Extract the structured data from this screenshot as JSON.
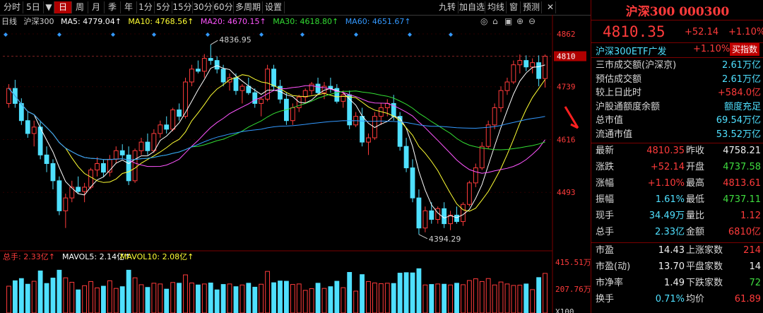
{
  "toolbar": {
    "left_items": [
      "分时",
      "5日",
      "▼",
      "日",
      "周",
      "月",
      "季",
      "年",
      "1分",
      "5分",
      "15分",
      "30分",
      "60分",
      "多周期",
      "设置"
    ],
    "active": "日",
    "right_items": [
      "九转",
      "加自选",
      "均线",
      "窗",
      "预测"
    ]
  },
  "legend": {
    "period": "日线",
    "name": "沪深300",
    "ma5": "MA5: 4779.04↑",
    "ma10": "MA10: 4768.56↑",
    "ma20": "MA20: 4670.15↑",
    "ma30": "MA30: 4618.80↑",
    "ma60": "MA60: 4651.67↑"
  },
  "vol_legend": {
    "total": "总手: 2.33亿↑",
    "mavol5": "MAVOL5: 2.14亿↑",
    "mavol10": "MAVOL10: 2.08亿↑"
  },
  "colors": {
    "up": "#ff3b3b",
    "down": "#4fe0ff",
    "ma5": "#ffffff",
    "ma10": "#ffff33",
    "ma20": "#ff55ff",
    "ma30": "#33dd33",
    "ma60": "#3399ff",
    "bg": "#000000"
  },
  "chart_data": {
    "type": "candlestick",
    "y_ticks": [
      "4862",
      "4810",
      "4739",
      "4616",
      "4493"
    ],
    "vol_ticks": [
      "415.51万",
      "207.76万",
      "X100"
    ],
    "annotations": {
      "high": "4836.95",
      "low": "4394.29"
    },
    "ylim": [
      4370,
      4880
    ],
    "ohlc": [
      [
        4700,
        4745,
        4690,
        4735
      ],
      [
        4735,
        4755,
        4690,
        4700
      ],
      [
        4700,
        4712,
        4650,
        4660
      ],
      [
        4660,
        4680,
        4620,
        4630
      ],
      [
        4630,
        4660,
        4600,
        4645
      ],
      [
        4645,
        4660,
        4570,
        4580
      ],
      [
        4580,
        4600,
        4540,
        4560
      ],
      [
        4560,
        4570,
        4500,
        4520
      ],
      [
        4520,
        4530,
        4440,
        4450
      ],
      [
        4450,
        4490,
        4410,
        4480
      ],
      [
        4480,
        4520,
        4470,
        4505
      ],
      [
        4505,
        4530,
        4490,
        4495
      ],
      [
        4495,
        4515,
        4470,
        4505
      ],
      [
        4505,
        4550,
        4500,
        4545
      ],
      [
        4545,
        4575,
        4530,
        4560
      ],
      [
        4560,
        4570,
        4530,
        4540
      ],
      [
        4540,
        4580,
        4530,
        4570
      ],
      [
        4570,
        4600,
        4560,
        4590
      ],
      [
        4590,
        4605,
        4570,
        4580
      ],
      [
        4580,
        4600,
        4510,
        4520
      ],
      [
        4520,
        4595,
        4515,
        4590
      ],
      [
        4590,
        4620,
        4580,
        4610
      ],
      [
        4610,
        4630,
        4580,
        4590
      ],
      [
        4590,
        4640,
        4585,
        4630
      ],
      [
        4630,
        4660,
        4620,
        4650
      ],
      [
        4650,
        4670,
        4630,
        4640
      ],
      [
        4640,
        4690,
        4635,
        4685
      ],
      [
        4685,
        4700,
        4660,
        4670
      ],
      [
        4670,
        4760,
        4665,
        4750
      ],
      [
        4750,
        4790,
        4740,
        4780
      ],
      [
        4780,
        4800,
        4770,
        4775
      ],
      [
        4775,
        4815,
        4760,
        4805
      ],
      [
        4805,
        4837,
        4790,
        4800
      ],
      [
        4800,
        4810,
        4770,
        4780
      ],
      [
        4780,
        4790,
        4740,
        4750
      ],
      [
        4750,
        4770,
        4730,
        4760
      ],
      [
        4760,
        4770,
        4720,
        4730
      ],
      [
        4730,
        4745,
        4700,
        4740
      ],
      [
        4740,
        4760,
        4720,
        4725
      ],
      [
        4725,
        4735,
        4690,
        4700
      ],
      [
        4700,
        4715,
        4670,
        4710
      ],
      [
        4710,
        4790,
        4705,
        4780
      ],
      [
        4780,
        4790,
        4730,
        4740
      ],
      [
        4740,
        4755,
        4700,
        4710
      ],
      [
        4710,
        4725,
        4650,
        4660
      ],
      [
        4660,
        4700,
        4650,
        4690
      ],
      [
        4690,
        4720,
        4680,
        4715
      ],
      [
        4715,
        4735,
        4700,
        4730
      ],
      [
        4730,
        4750,
        4720,
        4745
      ],
      [
        4745,
        4760,
        4720,
        4725
      ],
      [
        4725,
        4750,
        4710,
        4740
      ],
      [
        4740,
        4760,
        4725,
        4735
      ],
      [
        4735,
        4745,
        4700,
        4705
      ],
      [
        4705,
        4730,
        4690,
        4720
      ],
      [
        4720,
        4730,
        4640,
        4650
      ],
      [
        4650,
        4680,
        4645,
        4670
      ],
      [
        4670,
        4690,
        4600,
        4610
      ],
      [
        4610,
        4630,
        4580,
        4620
      ],
      [
        4620,
        4680,
        4615,
        4670
      ],
      [
        4670,
        4700,
        4650,
        4690
      ],
      [
        4690,
        4710,
        4670,
        4700
      ],
      [
        4700,
        4720,
        4660,
        4670
      ],
      [
        4670,
        4680,
        4590,
        4600
      ],
      [
        4600,
        4620,
        4540,
        4550
      ],
      [
        4550,
        4570,
        4470,
        4480
      ],
      [
        4480,
        4500,
        4395,
        4410
      ],
      [
        4410,
        4460,
        4400,
        4450
      ],
      [
        4450,
        4470,
        4420,
        4430
      ],
      [
        4430,
        4460,
        4420,
        4455
      ],
      [
        4455,
        4470,
        4410,
        4420
      ],
      [
        4420,
        4450,
        4405,
        4440
      ],
      [
        4440,
        4460,
        4420,
        4425
      ],
      [
        4425,
        4470,
        4415,
        4465
      ],
      [
        4465,
        4520,
        4460,
        4515
      ],
      [
        4515,
        4560,
        4505,
        4550
      ],
      [
        4550,
        4610,
        4545,
        4600
      ],
      [
        4600,
        4660,
        4595,
        4650
      ],
      [
        4650,
        4700,
        4640,
        4690
      ],
      [
        4690,
        4740,
        4680,
        4730
      ],
      [
        4730,
        4760,
        4720,
        4750
      ],
      [
        4750,
        4800,
        4745,
        4790
      ],
      [
        4790,
        4814,
        4770,
        4800
      ],
      [
        4800,
        4812,
        4775,
        4785
      ],
      [
        4785,
        4805,
        4770,
        4795
      ],
      [
        4795,
        4812,
        4740,
        4758
      ],
      [
        4758,
        4814,
        4737,
        4810
      ]
    ]
  },
  "side": {
    "title": "沪深300 000300",
    "price": "4810.35",
    "change": "+52.14",
    "change_pct": "+1.10%",
    "etf_name": "沪深300ETF广发",
    "etf_chg": "+1.10%",
    "etf_btn": "买指数",
    "stats": [
      {
        "label": "三市成交额(沪深京)",
        "value": "2.61万亿",
        "color": "cyan"
      },
      {
        "label": "预估成交额",
        "value": "2.61万亿",
        "color": "cyan"
      },
      {
        "label": "较上日此时",
        "value": "+584.0亿",
        "color": "red"
      },
      {
        "label": "沪股通额度余额",
        "value": "额度充足",
        "color": "cyan"
      },
      {
        "label": "总市值",
        "value": "69.54万亿",
        "color": "cyan"
      },
      {
        "label": "流通市值",
        "value": "53.52万亿",
        "color": "cyan"
      }
    ],
    "quotes": [
      {
        "l1": "最新",
        "v1": "4810.35",
        "c1": "red",
        "l2": "昨收",
        "v2": "4758.21",
        "c2": "white"
      },
      {
        "l1": "涨跌",
        "v1": "+52.14",
        "c1": "red",
        "l2": "开盘",
        "v2": "4737.58",
        "c2": "green"
      },
      {
        "l1": "涨幅",
        "v1": "+1.10%",
        "c1": "red",
        "l2": "最高",
        "v2": "4813.61",
        "c2": "red"
      },
      {
        "l1": "振幅",
        "v1": "1.61%",
        "c1": "cyan",
        "l2": "最低",
        "v2": "4737.11",
        "c2": "green"
      },
      {
        "l1": "现手",
        "v1": "34.49万",
        "c1": "cyan",
        "l2": "量比",
        "v2": "1.12",
        "c2": "red"
      },
      {
        "l1": "总手",
        "v1": "2.33亿",
        "c1": "cyan",
        "l2": "金额",
        "v2": "6810亿",
        "c2": "red"
      }
    ],
    "quotes2": [
      {
        "l1": "市盈",
        "v1": "14.43",
        "c1": "white",
        "l2": "上涨家数",
        "v2": "214",
        "c2": "red"
      },
      {
        "l1": "市盈(动)",
        "v1": "13.70",
        "c1": "white",
        "l2": "平盘家数",
        "v2": "14",
        "c2": "white"
      },
      {
        "l1": "市净率",
        "v1": "1.49",
        "c1": "white",
        "l2": "下跌家数",
        "v2": "72",
        "c2": "green"
      },
      {
        "l1": "换手",
        "v1": "0.71%",
        "c1": "cyan",
        "l2": "均价",
        "v2": "61.89",
        "c2": "red"
      }
    ]
  }
}
